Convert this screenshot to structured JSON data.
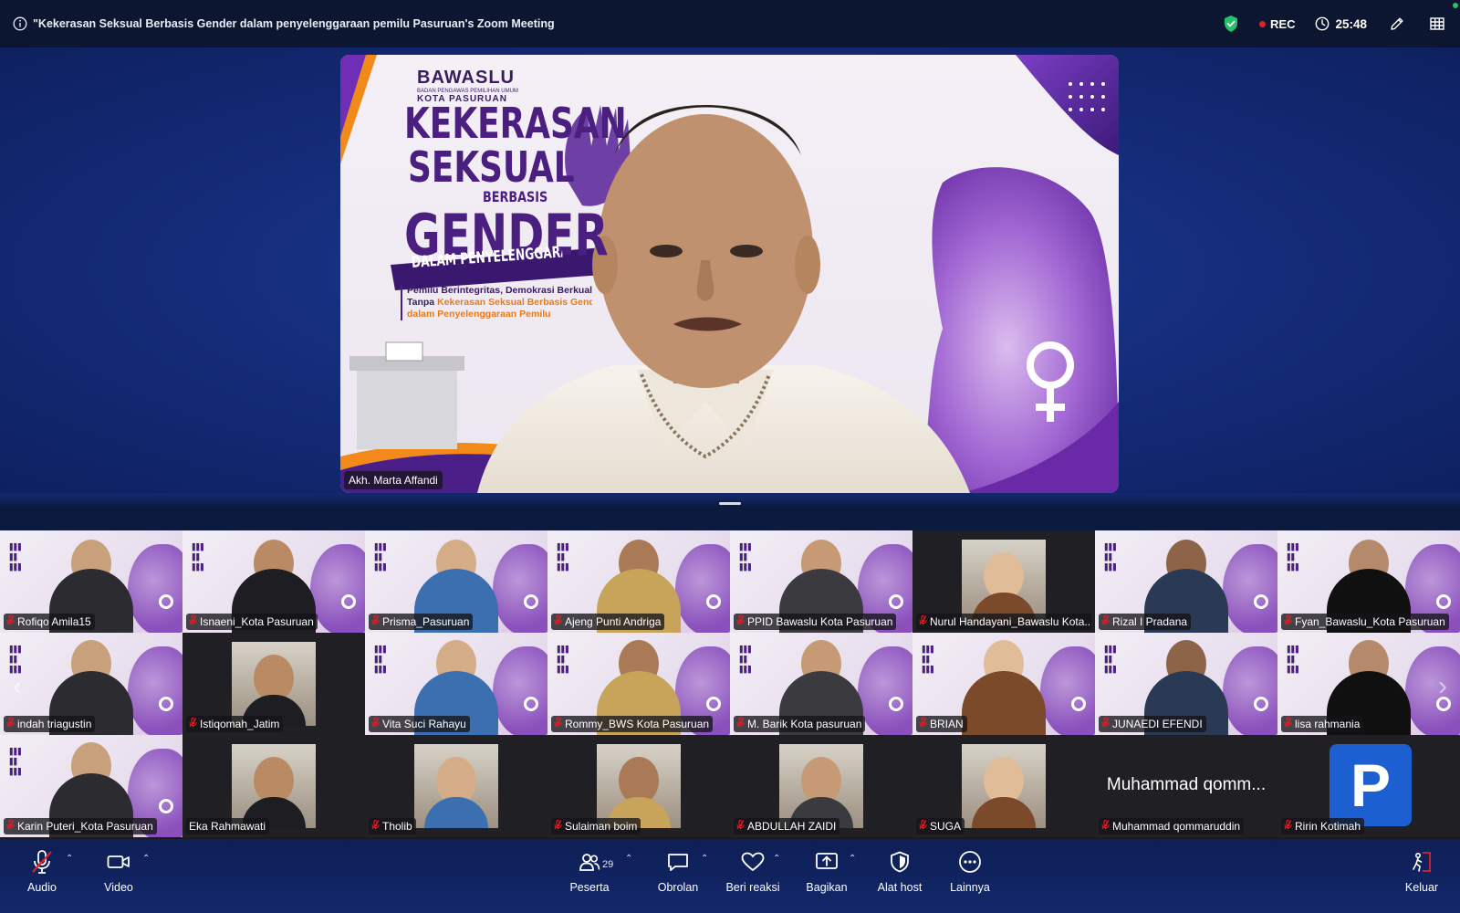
{
  "meeting": {
    "title": "\"Kekerasan Seksual Berbasis Gender dalam penyelenggaraan pemilu Pasuruan's Zoom Meeting",
    "rec_label": "REC",
    "timer": "25:48"
  },
  "speaker": {
    "name": "Akh. Marta Affandi",
    "slide": {
      "logo_title": "BAWASLU",
      "logo_sub1": "BADAN PENGAWAS PEMILIHAN UMUM",
      "logo_sub2": "KOTA PASURUAN",
      "line1": "KEKERASAN",
      "line2": "SEKSUAL",
      "line3": "BERBASIS",
      "line4": "GENDER",
      "ribbon": "DALAM PENYELENGGARAAN PEMILU",
      "tag1": "Pemilu Berintegritas, Demokrasi Berkualitas",
      "tag2": "Tanpa",
      "tag2b": "Kekerasan Seksual Berbasis Gender",
      "tag3": "dalam Penyelenggaraan Pemilu"
    }
  },
  "gallery": {
    "row1": [
      {
        "name": "Rofiqo Amila15",
        "muted": true
      },
      {
        "name": "Isnaeni_Kota Pasuruan",
        "muted": true
      },
      {
        "name": "Prisma_Pasuruan",
        "muted": true
      },
      {
        "name": "Ajeng Punti Andriga",
        "muted": true
      },
      {
        "name": "PPID Bawaslu Kota Pasuruan",
        "muted": true
      },
      {
        "name": "Nurul Handayani_Bawaslu Kota...",
        "muted": true
      },
      {
        "name": "Rizal I Pradana",
        "muted": true
      },
      {
        "name": "Fyan_Bawaslu_Kota Pasuruan",
        "muted": true
      }
    ],
    "row2": [
      {
        "name": "indah triagustin",
        "muted": true
      },
      {
        "name": "Istiqomah_Jatim",
        "muted": true
      },
      {
        "name": "Vita Suci Rahayu",
        "muted": true
      },
      {
        "name": "Rommy_BWS Kota Pasuruan",
        "muted": true
      },
      {
        "name": "M. Barik Kota pasuruan",
        "muted": true
      },
      {
        "name": "BRIAN",
        "muted": true
      },
      {
        "name": "JUNAEDI EFENDI",
        "muted": true
      },
      {
        "name": "lisa rahmania",
        "muted": true
      }
    ],
    "row3": [
      {
        "name": "Karin Puteri_Kota Pasuruan",
        "muted": true
      },
      {
        "name": "Eka Rahmawati",
        "muted": false
      },
      {
        "name": "Tholib",
        "muted": true
      },
      {
        "name": "Sulaiman boim",
        "muted": true
      },
      {
        "name": "ABDULLAH ZAIDI",
        "muted": true
      },
      {
        "name": "SUGA",
        "muted": true
      },
      {
        "name": "Muhammad qommaruddin",
        "muted": true,
        "display_text": "Muhammad qomm..."
      },
      {
        "name": "Ririn Kotimah",
        "muted": true,
        "avatar_letter": "P"
      }
    ]
  },
  "toolbar": {
    "audio": "Audio",
    "video": "Video",
    "participants": "Peserta",
    "participant_count": "29",
    "chat": "Obrolan",
    "react": "Beri reaksi",
    "share": "Bagikan",
    "host_tools": "Alat host",
    "more": "Lainnya",
    "leave": "Keluar"
  },
  "colors": {
    "topbar_bg": "#0d1630",
    "stage_bg": "#142b78",
    "toolbar_bg": "#13276a",
    "rec_red": "#e0212c",
    "shield_green": "#23c16b",
    "leave_red": "#e0212c",
    "slide_purple": "#4a1f80"
  }
}
